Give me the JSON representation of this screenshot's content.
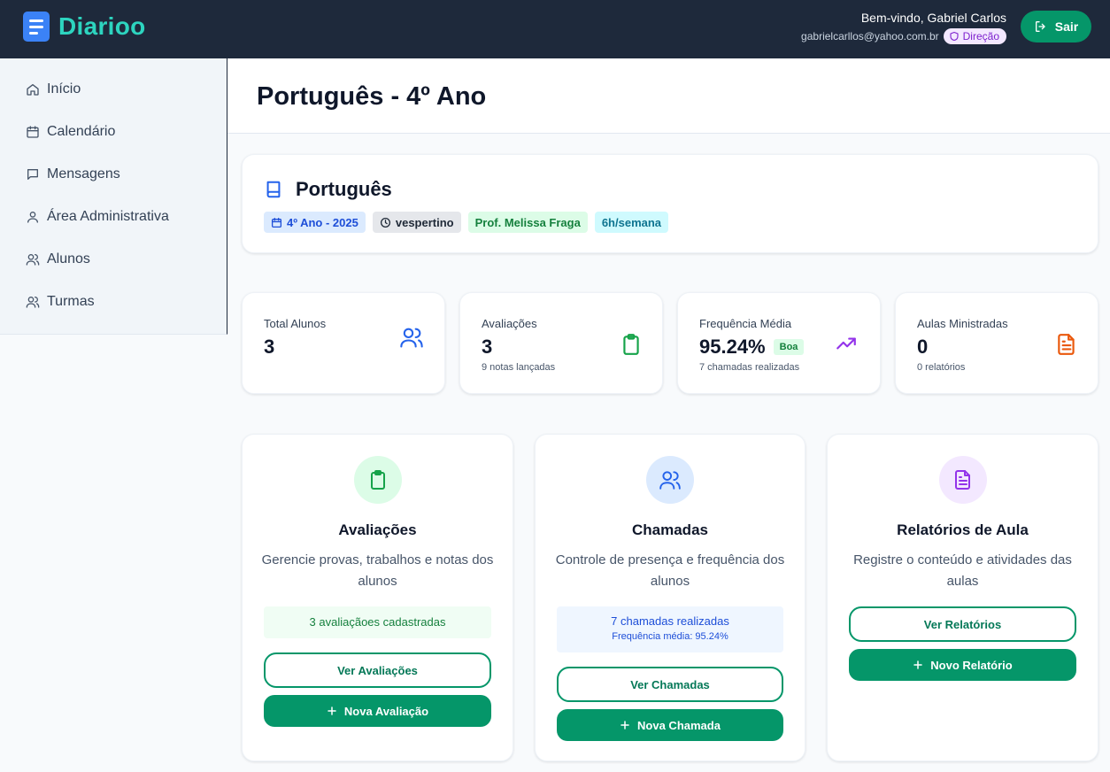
{
  "app": {
    "name": "Diarioo"
  },
  "header": {
    "welcome": "Bem-vindo, Gabriel Carlos",
    "email": "gabrielcarllos@yahoo.com.br",
    "role": "Direção",
    "logout_label": "Sair"
  },
  "sidebar": {
    "items": [
      {
        "label": "Início",
        "icon": "home-icon"
      },
      {
        "label": "Calendário",
        "icon": "calendar-icon"
      },
      {
        "label": "Mensagens",
        "icon": "message-icon"
      },
      {
        "label": "Área Administrativa",
        "icon": "user-icon"
      },
      {
        "label": "Alunos",
        "icon": "users-icon"
      },
      {
        "label": "Turmas",
        "icon": "users-icon"
      }
    ]
  },
  "page": {
    "title": "Português - 4º Ano"
  },
  "subject": {
    "name": "Português",
    "tags": {
      "class_year": "4º Ano - 2025",
      "shift": "vespertino",
      "teacher": "Prof. Melissa Fraga",
      "hours": "6h/semana"
    }
  },
  "stats": {
    "total_students": {
      "label": "Total Alunos",
      "value": "3"
    },
    "assessments": {
      "label": "Avaliações",
      "value": "3",
      "sub": "9 notas lançadas"
    },
    "attendance": {
      "label": "Frequência Média",
      "value": "95.24%",
      "badge": "Boa",
      "sub": "7 chamadas realizadas"
    },
    "lessons": {
      "label": "Aulas Ministradas",
      "value": "0",
      "sub": "0 relatórios"
    }
  },
  "actions": {
    "assessments": {
      "title": "Avaliações",
      "description": "Gerencie provas, trabalhos e notas dos alunos",
      "info": "3 avaliaçãoes cadastradas",
      "view_label": "Ver Avaliações",
      "new_label": "Nova Avaliação"
    },
    "calls": {
      "title": "Chamadas",
      "description": "Controle de presença e frequência dos alunos",
      "info": "7 chamadas realizadas",
      "info_sub": "Frequência média: 95.24%",
      "view_label": "Ver Chamadas",
      "new_label": "Nova Chamada"
    },
    "reports": {
      "title": "Relatórios de Aula",
      "description": "Registre o conteúdo e atividades das aulas",
      "view_label": "Ver Relatórios",
      "new_label": "Novo Relatório"
    }
  },
  "colors": {
    "header_bg": "#1e293b",
    "brand_teal": "#2dd4bf",
    "primary_green": "#059669",
    "icon_blue": "#2563eb",
    "icon_purple": "#9333ea",
    "icon_orange": "#ea580c"
  }
}
